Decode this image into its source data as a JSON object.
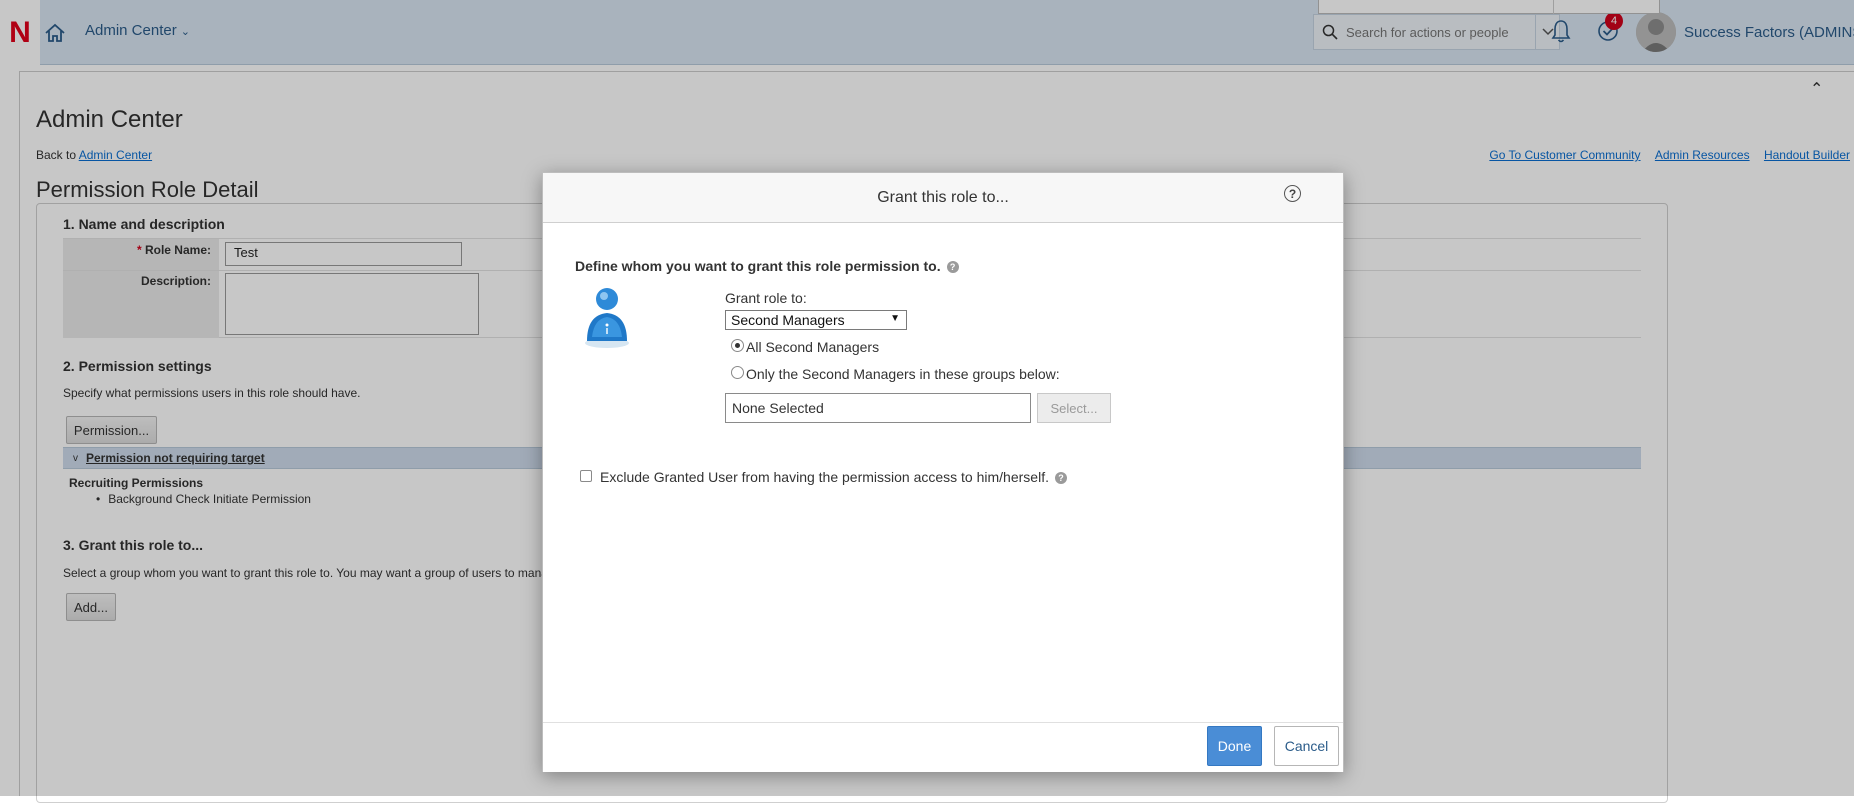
{
  "header": {
    "logo_letter": "N",
    "module_label": "Admin Center",
    "search_placeholder": "Search for actions or people",
    "notification_count": "4",
    "user_name": "Success Factors (ADMINSF)"
  },
  "page": {
    "title": "Admin Center",
    "back_prefix": "Back to ",
    "back_link": "Admin Center",
    "links": [
      "Go To Customer Community",
      "Admin Resources",
      "Handout Builder"
    ],
    "heading": "Permission Role Detail",
    "section1": {
      "title": "1. Name and description",
      "role_name_label": "Role Name:",
      "required_mark": "*",
      "role_name_value": "Test",
      "description_label": "Description:"
    },
    "section2": {
      "title": "2. Permission settings",
      "desc": "Specify what permissions users in this role should have.",
      "button": "Permission...",
      "bar_chevron": "v",
      "bar_label": "Permission not requiring target",
      "group_title": "Recruiting Permissions",
      "items": [
        "Background Check Initiate Permission"
      ]
    },
    "section3": {
      "title": "3. Grant this role to...",
      "desc": "Select a group whom you want to grant this role to. You may want a group of users to mana",
      "button": "Add..."
    }
  },
  "dialog": {
    "title": "Grant this role to...",
    "help": "?",
    "define_text": "Define whom you want to grant this role permission to.",
    "grant_label": "Grant role to:",
    "grant_value": "Second Managers",
    "radio_all": "All Second Managers",
    "radio_only": "Only the Second Managers in these groups below:",
    "none_selected": "None Selected",
    "select_button": "Select...",
    "exclude_label": "Exclude Granted User from having the permission access to him/herself.",
    "done": "Done",
    "cancel": "Cancel"
  }
}
